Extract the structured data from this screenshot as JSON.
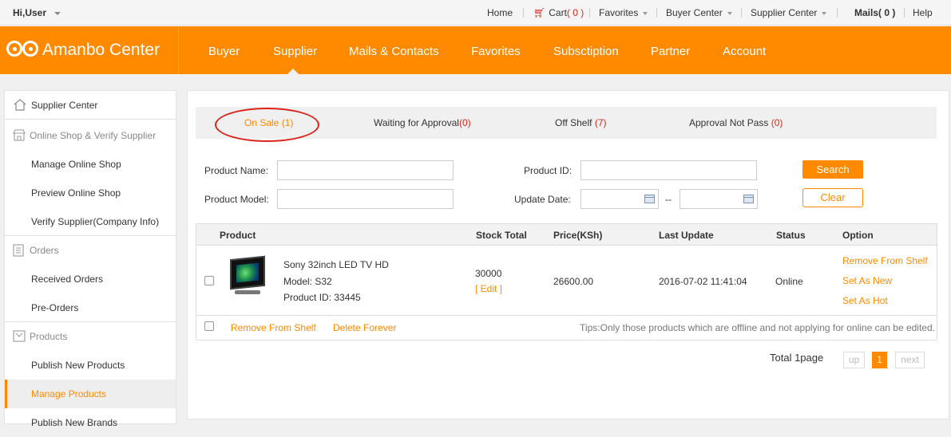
{
  "topbar": {
    "greeting": "Hi,User",
    "home": "Home",
    "cart_label": "Cart",
    "cart_count": "( 0 )",
    "favorites": "Favorites",
    "buyer_center": "Buyer Center",
    "supplier_center": "Supplier Center",
    "mails_label": "Mails",
    "mails_count": "( 0 )",
    "help": "Help"
  },
  "header": {
    "logo": "Amanbo Center",
    "nav": [
      "Buyer",
      "Supplier",
      "Mails & Contacts",
      "Favorites",
      "Subsctiption",
      "Partner",
      "Account"
    ],
    "active_nav": "Supplier"
  },
  "sidebar": {
    "items": [
      {
        "label": "Supplier Center",
        "type": "section",
        "icon": "home-icon"
      },
      {
        "label": "Online Shop & Verify Supplier",
        "type": "section",
        "icon": "shop-icon"
      },
      {
        "label": "Manage Online Shop",
        "type": "link"
      },
      {
        "label": "Preview Online Shop",
        "type": "link"
      },
      {
        "label": "Verify Supplier(Company Info)",
        "type": "link"
      },
      {
        "label": "Orders",
        "type": "section",
        "icon": "list-icon"
      },
      {
        "label": "Received Orders",
        "type": "link"
      },
      {
        "label": "Pre-Orders",
        "type": "link"
      },
      {
        "label": "Products",
        "type": "section",
        "icon": "box-icon"
      },
      {
        "label": "Publish New Products",
        "type": "link"
      },
      {
        "label": "Manage Products",
        "type": "link",
        "active": true
      },
      {
        "label": "Publish New Brands",
        "type": "link"
      }
    ]
  },
  "tabs": [
    {
      "label": "On Sale",
      "count": "(1)",
      "active": true
    },
    {
      "label": "Waiting for Approval",
      "count": "(0)"
    },
    {
      "label": "Off Shelf",
      "count": "(7)"
    },
    {
      "label": "Approval Not Pass",
      "count": "(0)"
    }
  ],
  "filters": {
    "product_name_label": "Product Name:",
    "product_model_label": "Product Model:",
    "product_id_label": "Product ID:",
    "update_date_label": "Update Date:",
    "date_separator": "--",
    "search_button": "Search",
    "clear_button": "Clear"
  },
  "table": {
    "headers": [
      "Product",
      "Stock Total",
      "Price(KSh)",
      "Last Update",
      "Status",
      "Option"
    ],
    "rows": [
      {
        "name": "Sony 32inch LED TV HD",
        "model": "Model: S32",
        "product_id": "Product ID: 33445",
        "stock": "30000",
        "edit": "[ Edit ]",
        "price": "26600.00",
        "last_update": "2016-07-02 11:41:04",
        "status": "Online",
        "options": [
          "Remove From Shelf",
          "Set As New",
          "Set As Hot"
        ]
      }
    ],
    "footer": {
      "remove_from_shelf": "Remove From Shelf",
      "delete_forever": "Delete Forever",
      "tips": "Tips:Only those products which are offline and not applying for online can be edited."
    }
  },
  "pagination": {
    "total": "Total 1page",
    "up": "up",
    "current": "1",
    "next": "next"
  },
  "colors": {
    "accent": "#ff8a00",
    "highlight_circle": "#d9251c"
  }
}
